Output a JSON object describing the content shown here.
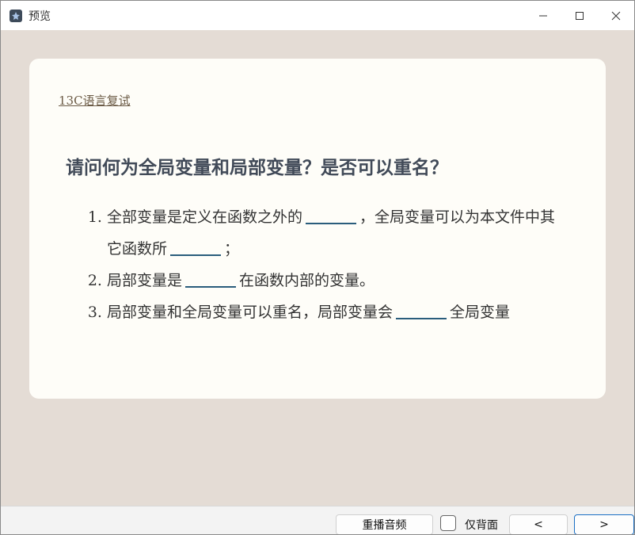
{
  "window": {
    "title": "预览",
    "minimize_glyph": "—",
    "maximize_glyph": "☐",
    "close_glyph": "✕"
  },
  "card": {
    "deck_name": "13C语言复试",
    "question": "请问何为全局变量和局部变量？是否可以重名？",
    "answers": [
      {
        "parts": [
          "全部变量是定义在函数之外的",
          "，全局变量可以为本文件中其它函数所",
          "；"
        ]
      },
      {
        "parts": [
          "局部变量是",
          "在函数内部的变量。"
        ]
      },
      {
        "parts": [
          "局部变量和全局变量可以重名，局部变量会",
          "全局变量"
        ]
      }
    ]
  },
  "toolbar": {
    "replay_audio": "重播音频",
    "back_only_label": "仅背面",
    "back_only_checked": false,
    "prev": "<",
    "next": ">"
  },
  "colors": {
    "background": "#e4dcd5",
    "card": "#fefdf8",
    "blank_line": "#2a5d7c",
    "question_text": "#414a58"
  }
}
